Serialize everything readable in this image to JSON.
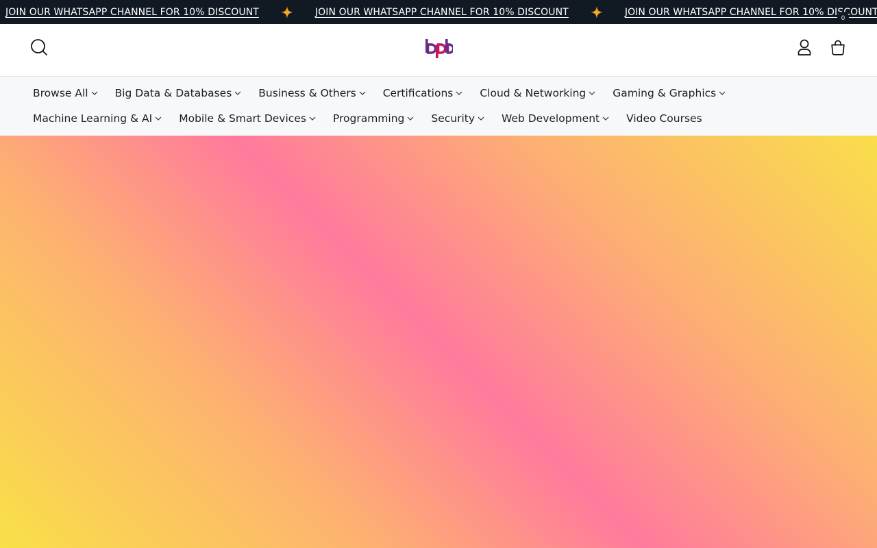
{
  "announcement": {
    "text": "JOIN OUR WHATSAPP CHANNEL FOR 10% DISCOUNT",
    "separator_icon": "sparkle-star-icon",
    "text_color": "#ffffff",
    "bg_color": "#111a22",
    "star_color": "#f5a623"
  },
  "header": {
    "logo_text": "bpb",
    "logo_color": "#6b2c86",
    "cart_count": "0",
    "icons": [
      "search-icon",
      "user-icon",
      "shopping-bag-icon"
    ]
  },
  "nav": {
    "row1": [
      {
        "label": "Browse All",
        "has_dropdown": true
      },
      {
        "label": "Big Data & Databases",
        "has_dropdown": true
      },
      {
        "label": "Business & Others",
        "has_dropdown": true
      },
      {
        "label": "Certifications",
        "has_dropdown": true
      },
      {
        "label": "Cloud & Networking",
        "has_dropdown": true
      },
      {
        "label": "Gaming & Graphics",
        "has_dropdown": true
      }
    ],
    "row2": [
      {
        "label": "Machine Learning & AI",
        "has_dropdown": true
      },
      {
        "label": "Mobile & Smart Devices",
        "has_dropdown": true
      },
      {
        "label": "Programming",
        "has_dropdown": true
      },
      {
        "label": "Security",
        "has_dropdown": true
      },
      {
        "label": "Web Development",
        "has_dropdown": true
      },
      {
        "label": "Video Courses",
        "has_dropdown": false
      }
    ]
  },
  "hero": {
    "gradient_colors": [
      "#f9e048",
      "#fdb36f",
      "#ff7a9c",
      "#fdae74",
      "#f9de4a"
    ]
  }
}
